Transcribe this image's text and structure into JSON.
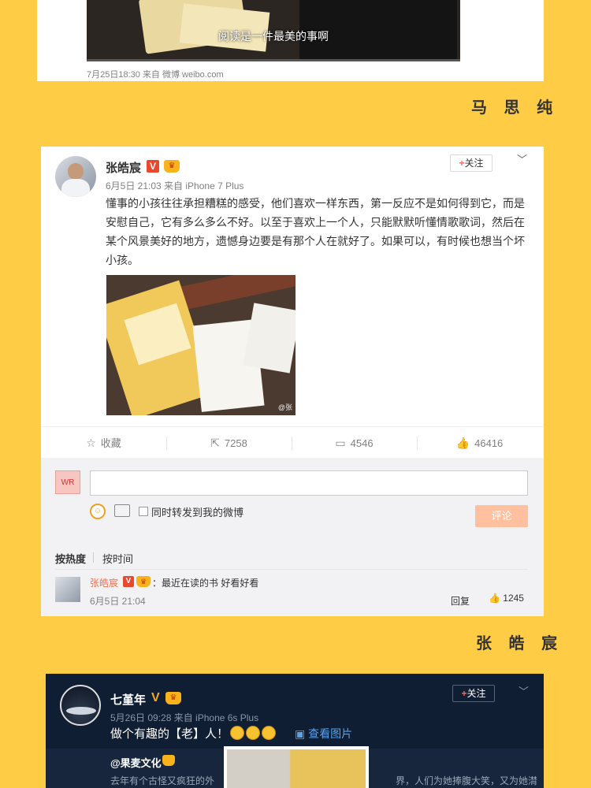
{
  "card1": {
    "video_subtitle": "阅读是一件最美的事啊",
    "meta": "7月25日18:30 来自 微博 weibo.com"
  },
  "section_names": [
    "马 思 纯",
    "张 皓 宸"
  ],
  "post": {
    "author": "张皓宸",
    "v_badge": "V",
    "time": "6月5日 21:03 来自 iPhone 7 Plus",
    "follow_label": "关注",
    "text": "懂事的小孩往往承担糟糕的感受，他们喜欢一样东西，第一反应不是如何得到它，而是安慰自己，它有多么多么不好。以至于喜欢上一个人，只能默默听懂情歌歌词，然后在某个风景美好的地方，遗憾身边要是有那个人在就好了。如果可以，有时候也想当个坏小孩。",
    "image_watermark": "@张",
    "actions": [
      {
        "icon": "star-icon",
        "glyph": "☆",
        "label": "收藏"
      },
      {
        "icon": "repost-icon",
        "glyph": "⇱",
        "label": "7258"
      },
      {
        "icon": "comment-icon",
        "glyph": "▭",
        "label": "4546"
      },
      {
        "icon": "like-icon",
        "glyph": "👍",
        "label": "46416"
      }
    ]
  },
  "comment_box": {
    "avatar_text": "WR",
    "input_value": "",
    "repost_label": "同时转发到我的微博",
    "submit_label": "评论",
    "sort_hot": "按热度",
    "sort_time": "按时间"
  },
  "top_comment": {
    "author": "张皓宸",
    "v_badge": "V",
    "text": "：最近在读的书 好看好看",
    "time": "6月5日 21:04",
    "reply_label": "回复",
    "likes": "1245"
  },
  "card3": {
    "author": "七堇年",
    "v_badge": "V",
    "time": "5月26日 09:28 来自 iPhone 6s Plus",
    "follow_label": "关注",
    "text": "做个有趣的【老】人！",
    "view_images": "查看图片",
    "repost_author": "@果麦文化",
    "repost_text_left": "去年有个古怪又疯狂的外",
    "repost_text_right": "界，人们为她捧腹大笑，又为她潸"
  }
}
